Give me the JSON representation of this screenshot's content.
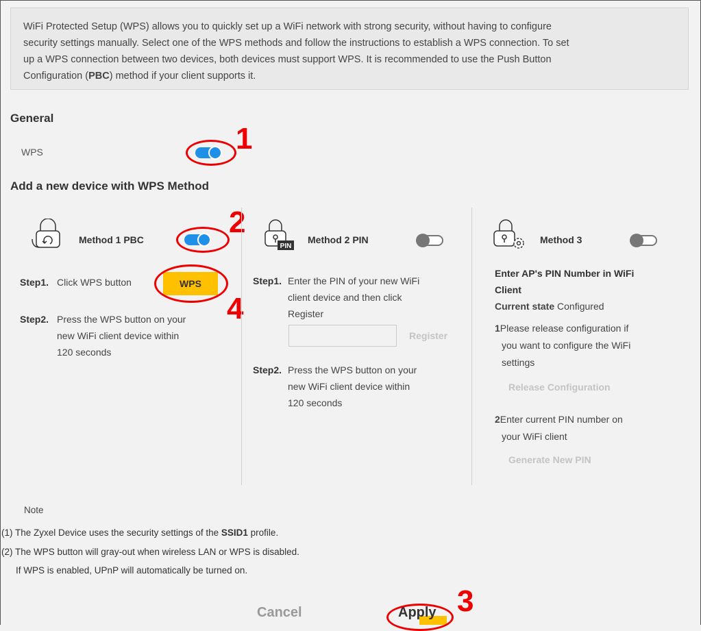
{
  "intro": {
    "text_line1": "WiFi Protected Setup (WPS) allows you to quickly set up a WiFi network with strong security, without having to configure",
    "text_line2": "security settings manually. Select one of the WPS methods and follow the instructions to establish a WPS connection. To set",
    "text_line3": "up a WPS connection between two devices, both devices must support WPS. It is recommended to use the Push Button",
    "text_line4_pre": "Configuration (",
    "text_line4_bold": "PBC",
    "text_line4_post": ") method if your client supports it."
  },
  "general": {
    "title": "General",
    "wps_label": "WPS",
    "wps_enabled": true
  },
  "add_device": {
    "title": "Add a new device with WPS Method"
  },
  "method1": {
    "title": "Method 1 PBC",
    "enabled": true,
    "step1_label": "Step1.",
    "step1_text": "Click WPS button",
    "wps_button": "WPS",
    "step2_label": "Step2.",
    "step2_l1": "Press the WPS button on your",
    "step2_l2": "new WiFi client device within",
    "step2_l3": "120 seconds"
  },
  "method2": {
    "title": "Method 2 PIN",
    "enabled": false,
    "icon_text": "PIN",
    "step1_label": "Step1.",
    "step1_l1": "Enter the PIN of your new WiFi",
    "step1_l2": "client device and then click",
    "step1_l3": "Register",
    "pin_value": "",
    "register_button": "Register",
    "step2_label": "Step2.",
    "step2_l1": "Press the WPS button on your",
    "step2_l2": "new WiFi client device within",
    "step2_l3": "120 seconds"
  },
  "method3": {
    "title": "Method 3",
    "enabled": false,
    "heading_l1": "Enter AP's PIN Number in WiFi",
    "heading_l2": "Client",
    "state_label": "Current state",
    "state_value": "Configured",
    "item1_num": "1",
    "item1_l1": "Please release configuration if",
    "item1_l2": "you want to configure the WiFi",
    "item1_l3": "settings",
    "release_button": "Release Configuration",
    "item2_num": "2",
    "item2_l1": "Enter current PIN number on",
    "item2_l2": "your WiFi client",
    "generate_button": "Generate New PIN"
  },
  "notes": {
    "title": "Note",
    "n1_pre": "(1) The Zyxel Device uses the security settings of the ",
    "n1_bold": "SSID1",
    "n1_post": " profile.",
    "n2_l1": "(2) The WPS button will gray-out when wireless LAN or WPS is disabled.",
    "n2_l2": "If WPS is enabled, UPnP will automatically be turned on."
  },
  "actions": {
    "cancel": "Cancel",
    "apply": "Apply"
  },
  "callouts": {
    "c1": "1",
    "c2": "2",
    "c3": "3",
    "c4": "4"
  },
  "colors": {
    "accent_blue": "#1e90e8",
    "wps_yellow": "#ffc000",
    "callout_red": "#e00000"
  }
}
